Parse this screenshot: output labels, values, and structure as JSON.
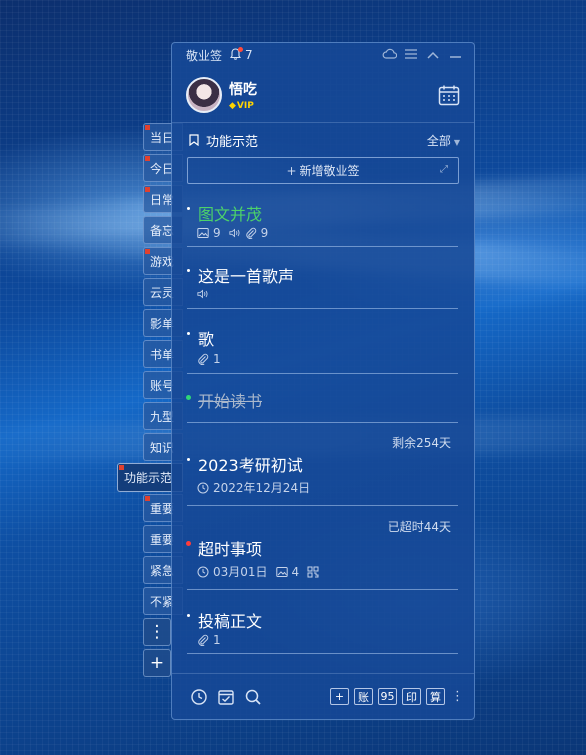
{
  "app": {
    "name": "敬业签",
    "reminder_count": "7"
  },
  "user": {
    "name": "悟吃",
    "badge": "VIP"
  },
  "section": {
    "title": "功能示范",
    "filter": "全部"
  },
  "add_note_label": "新增敬业签",
  "side_tabs": [
    {
      "label": "当日",
      "flag": true
    },
    {
      "label": "今日",
      "flag": true
    },
    {
      "label": "日常",
      "flag": true
    },
    {
      "label": "备忘",
      "flag": false
    },
    {
      "label": "游戏",
      "flag": true
    },
    {
      "label": "云灵",
      "flag": false
    },
    {
      "label": "影单",
      "flag": false
    },
    {
      "label": "书单",
      "flag": false
    },
    {
      "label": "账号",
      "flag": false
    },
    {
      "label": "九型",
      "flag": false
    },
    {
      "label": "知识",
      "flag": false
    },
    {
      "label": "功能示范",
      "flag": true,
      "active": true
    },
    {
      "label": "重要",
      "flag": true
    },
    {
      "label": "重要",
      "flag": false
    },
    {
      "label": "紧急",
      "flag": false
    },
    {
      "label": "不紧",
      "flag": false
    }
  ],
  "notes": [
    {
      "title": "图文并茂",
      "images": "9",
      "attachments": "9"
    },
    {
      "title": "这是一首歌声"
    },
    {
      "title": "歌",
      "attachments": "1"
    },
    {
      "title": "开始读书"
    },
    {
      "title": "2023考研初试",
      "remain": "剩余254天",
      "date": "2022年12月24日"
    },
    {
      "title": "超时事项",
      "remain": "已超时44天",
      "date": "03月01日",
      "images": "4"
    },
    {
      "title": "投稿正文",
      "attachments": "1"
    }
  ],
  "bottom_buttons": [
    "账",
    "95",
    "印",
    "算"
  ]
}
